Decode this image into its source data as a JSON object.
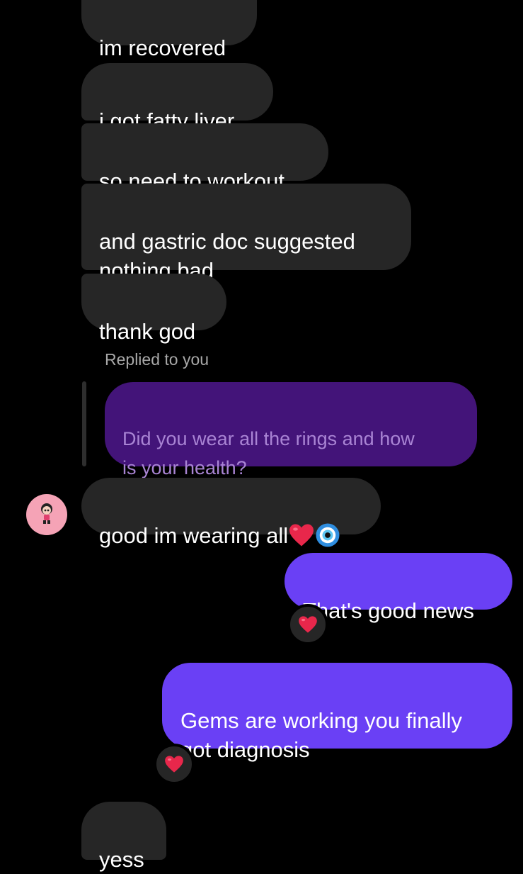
{
  "received": [
    {
      "text": "im recovered"
    },
    {
      "text": "i got fatty liver"
    },
    {
      "text": "so need to workout"
    },
    {
      "text": "and gastric doc suggested\nnothing bad"
    },
    {
      "text": "thank god"
    }
  ],
  "reply": {
    "label": "Replied to you",
    "quoted_text": "Did you wear all the rings and how\nis your health?"
  },
  "reply_message": {
    "text": "good im wearing all"
  },
  "sent": [
    {
      "text": "That's good news",
      "reaction": "heart-icon"
    },
    {
      "text": "Gems are working you finally\ngot diagnosis",
      "reaction": "heart-icon"
    }
  ],
  "last_received": {
    "text": "yess"
  },
  "colors": {
    "background": "#000000",
    "received_bubble": "#262626",
    "sent_bubble": "#6a40f5",
    "quoted_bubble": "#431479",
    "heart": "#e8274b"
  }
}
